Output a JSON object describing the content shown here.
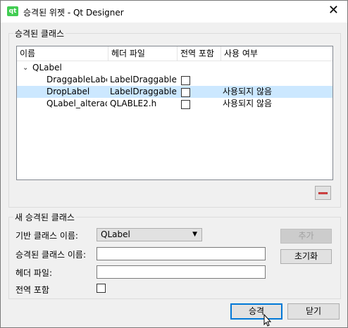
{
  "window": {
    "title": "승격된 위젯 - Qt Designer",
    "icon_label": "qt"
  },
  "promoted_group": {
    "title": "승격된 클래스",
    "columns": [
      "이름",
      "헤더 파일",
      "전역 포함",
      "사용 여부"
    ],
    "base_class": "QLabel",
    "rows": [
      {
        "name": "DraggableLabel",
        "header": "LabelDraggable",
        "global": false,
        "usage": "",
        "selected": false
      },
      {
        "name": "DropLabel",
        "header": "LabelDraggable.h",
        "global": false,
        "usage": "사용되지 않음",
        "selected": true
      },
      {
        "name": "QLabel_alterada",
        "header": "QLABLE2.h",
        "global": false,
        "usage": "사용되지 않음",
        "selected": false
      }
    ]
  },
  "new_group": {
    "title": "새 승격된 클래스",
    "base_label": "기반 클래스 이름:",
    "base_value": "QLabel",
    "promoted_label": "승격된 클래스 이름:",
    "promoted_value": "",
    "header_label": "헤더 파일:",
    "header_value": "",
    "global_label": "전역 포함",
    "add_label": "추가",
    "reset_label": "초기화"
  },
  "footer": {
    "promote_label": "승격",
    "close_label": "닫기"
  }
}
